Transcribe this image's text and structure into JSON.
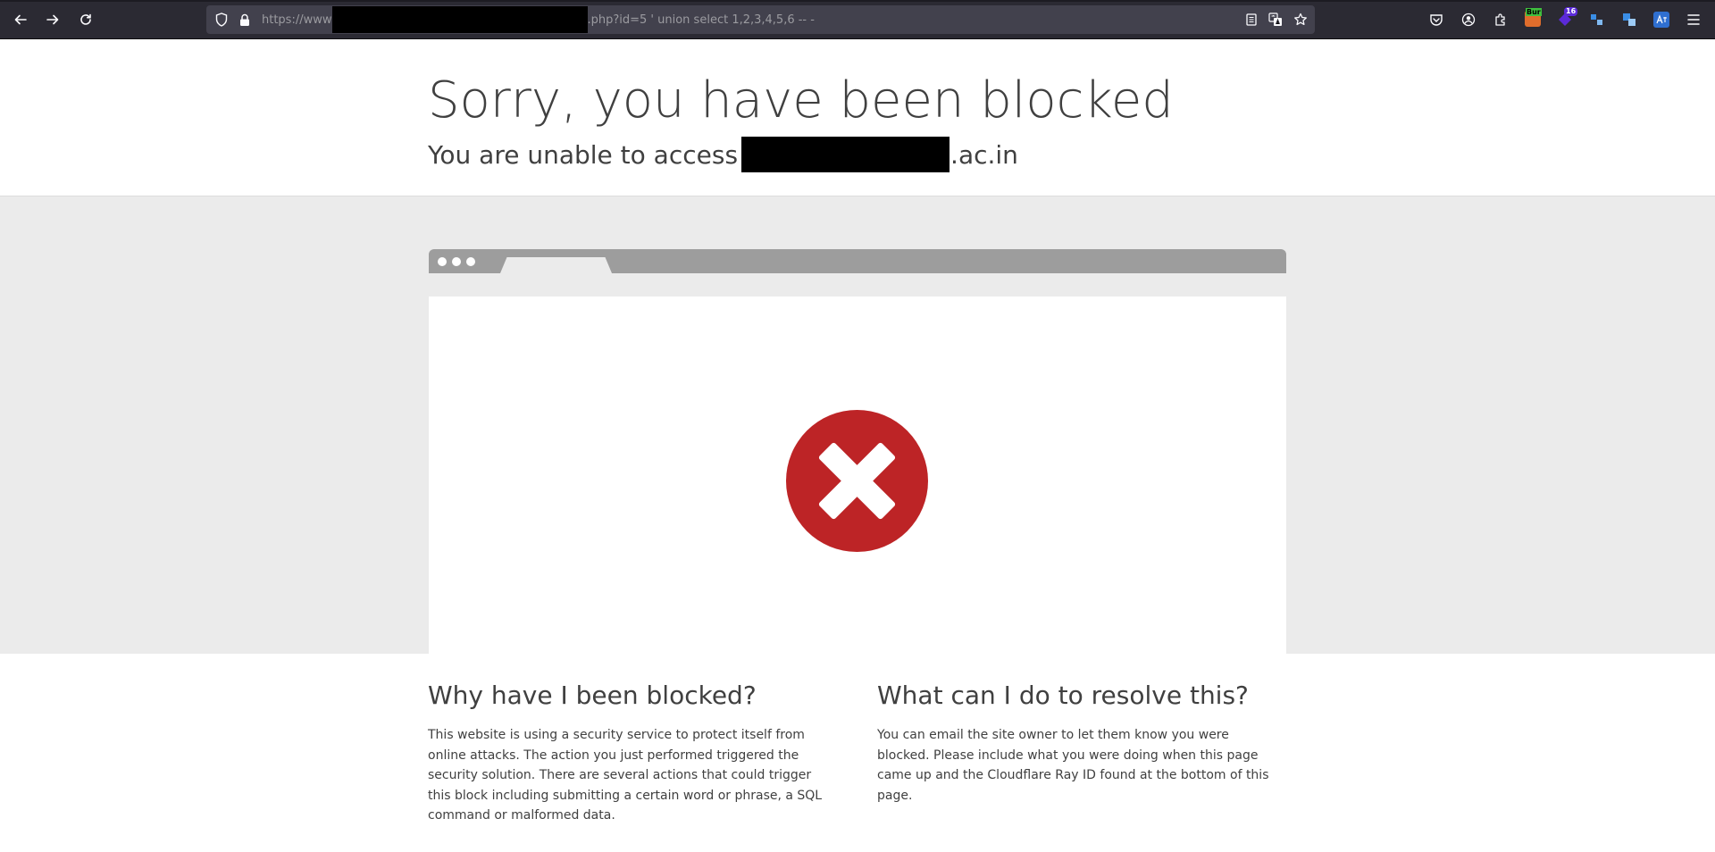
{
  "browser": {
    "url_prefix": "https://www",
    "url_suffix": ".php?id=5 ' union select 1,2,3,4,5,6 -- -",
    "nav": {
      "back_icon": "back-arrow-icon",
      "forward_icon": "forward-arrow-icon",
      "reload_icon": "reload-icon"
    },
    "extensions": {
      "burp_label": "Bur",
      "badge_count": "16"
    }
  },
  "page": {
    "title": "Sorry, you have been blocked",
    "subtitle_prefix": "You are unable to access",
    "subtitle_suffix": ".ac.in",
    "why_heading": "Why have I been blocked?",
    "why_text": "This website is using a security service to protect itself from online attacks. The action you just performed triggered the security solution. There are several actions that could trigger this block including submitting a certain word or phrase, a SQL command or malformed data.",
    "resolve_heading": "What can I do to resolve this?",
    "resolve_text": "You can email the site owner to let them know you were blocked. Please include what you were doing when this page came up and the Cloudflare Ray ID found at the bottom of this page."
  },
  "colors": {
    "error_red": "#bd2426",
    "band_grey": "#ebebeb",
    "text": "#404040"
  }
}
